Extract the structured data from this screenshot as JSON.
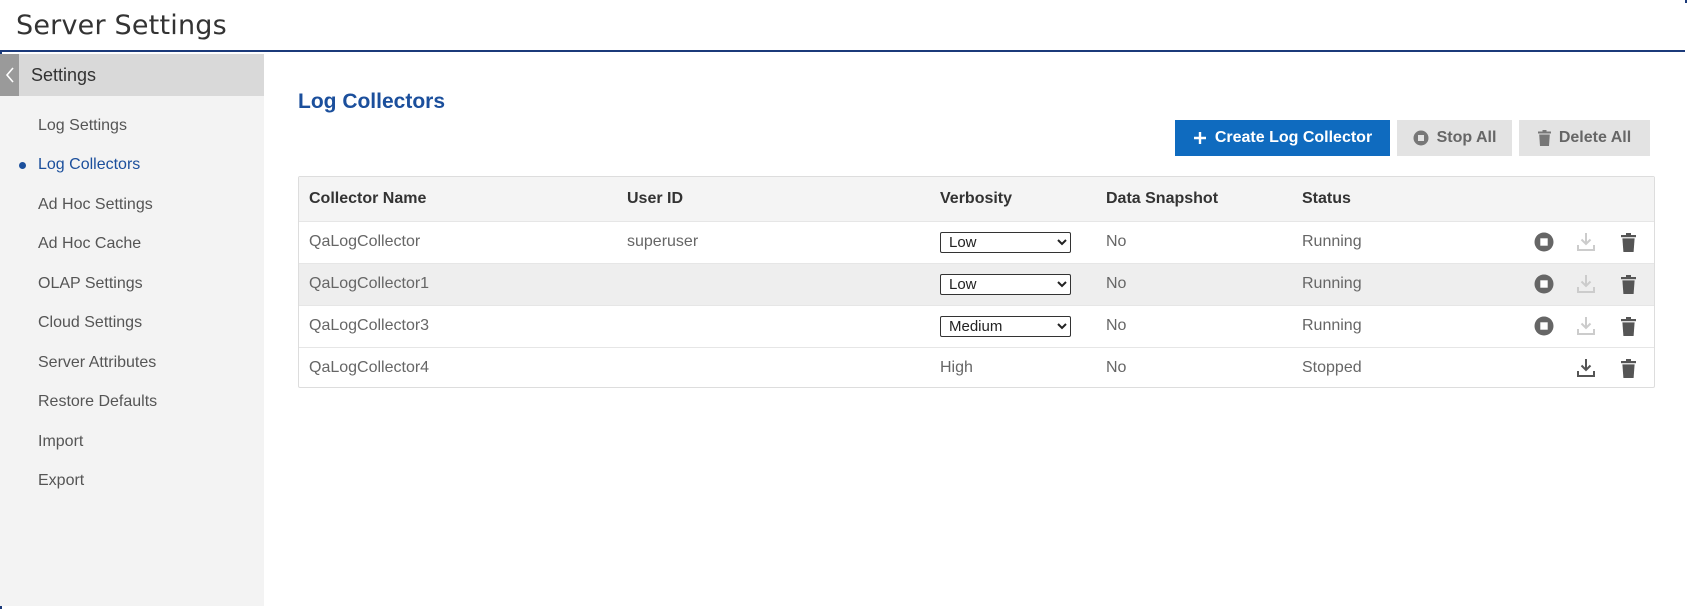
{
  "header": {
    "title": "Server Settings"
  },
  "sidebar": {
    "title": "Settings",
    "items": [
      {
        "label": "Log Settings",
        "active": false
      },
      {
        "label": "Log Collectors",
        "active": true
      },
      {
        "label": "Ad Hoc Settings",
        "active": false
      },
      {
        "label": "Ad Hoc Cache",
        "active": false
      },
      {
        "label": "OLAP Settings",
        "active": false
      },
      {
        "label": "Cloud Settings",
        "active": false
      },
      {
        "label": "Server Attributes",
        "active": false
      },
      {
        "label": "Restore Defaults",
        "active": false
      },
      {
        "label": "Import",
        "active": false
      },
      {
        "label": "Export",
        "active": false
      }
    ]
  },
  "main": {
    "title": "Log Collectors",
    "toolbar": {
      "create_label": "Create Log Collector",
      "stop_all_label": "Stop All",
      "delete_all_label": "Delete All"
    },
    "table": {
      "columns": [
        "Collector Name",
        "User ID",
        "Verbosity",
        "Data Snapshot",
        "Status"
      ],
      "rows": [
        {
          "name": "QaLogCollector",
          "user": "superuser",
          "verbosity": "Low",
          "snapshot": "No",
          "status": "Running"
        },
        {
          "name": "QaLogCollector1",
          "user": "",
          "verbosity": "Low",
          "snapshot": "No",
          "status": "Running"
        },
        {
          "name": "QaLogCollector3",
          "user": "",
          "verbosity": "Medium",
          "snapshot": "No",
          "status": "Running"
        },
        {
          "name": "QaLogCollector4",
          "user": "",
          "verbosity": "High",
          "snapshot": "No",
          "status": "Stopped"
        }
      ]
    }
  },
  "colors": {
    "accent": "#1b4f9c",
    "primary_button": "#0f6bbf",
    "frame": "#1b3a7a"
  },
  "icons": {
    "collapse": "chevron-left-icon",
    "create": "plus-icon",
    "stop": "stop-icon",
    "download": "download-icon",
    "delete": "trash-icon"
  }
}
